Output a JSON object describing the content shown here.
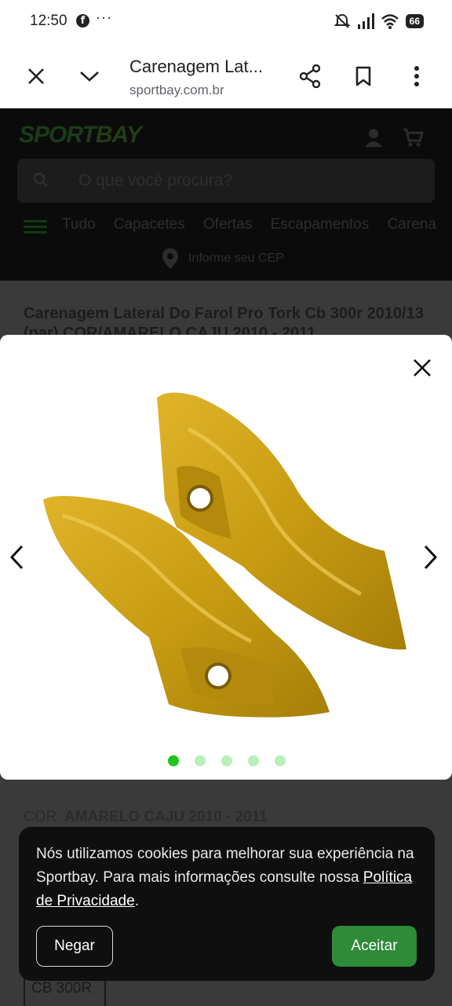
{
  "status_bar": {
    "time": "12:50",
    "dots": "···",
    "battery": "66",
    "icons": [
      "facebook-icon",
      "mute-icon",
      "signal-icon",
      "wifi-icon",
      "battery-icon"
    ]
  },
  "browser": {
    "page_title": "Carenagem Lat...",
    "url": "sportbay.com.br"
  },
  "site": {
    "logo_left": "SPORT",
    "logo_right": "BAY",
    "search_placeholder": "O que você procura?",
    "nav_items": [
      "Tudo",
      "Capacetes",
      "Ofertas",
      "Escapamentos",
      "Carena"
    ],
    "cep_label": "Informe seu CEP",
    "product_title": "Carenagem Lateral Do Farol Pro Tork Cb 300r 2010/13 (par) COR/AMARELO CAJU 2010 - 2011",
    "cor_label": "COR:",
    "cor_value": "AMARELO CAJU 2010 - 2011",
    "variant": "CB 300R"
  },
  "gallery": {
    "slide_count": 5,
    "active_index": 0,
    "image_alt": "yellow-side-fairings"
  },
  "cookie_banner": {
    "text": "Nós utilizamos cookies para melhorar sua experiência na Sportbay. Para mais informações consulte nossa ",
    "link": "Política de Privacidade",
    "period": ".",
    "deny_label": "Negar",
    "accept_label": "Aceitar"
  },
  "colors": {
    "accept_green": "#2e8b38",
    "dot_active": "#1ec41e",
    "dot_inactive": "#b9efb9",
    "part_yellow": "#c9a21a"
  }
}
